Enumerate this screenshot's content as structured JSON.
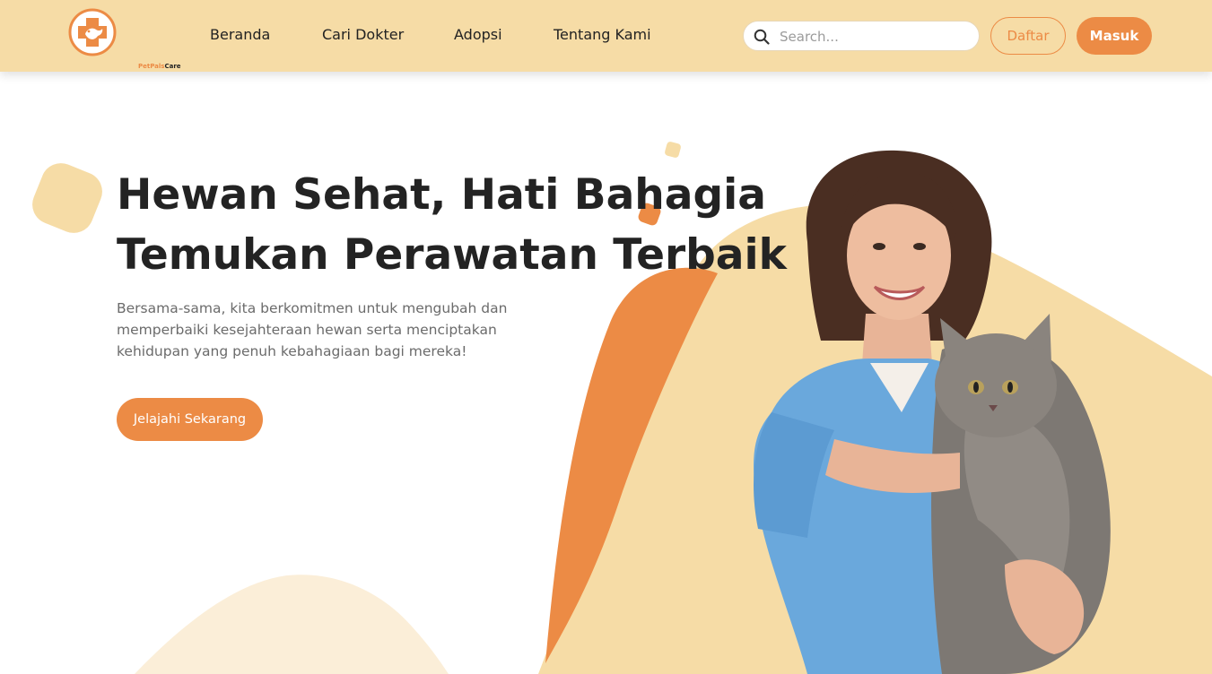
{
  "brand": {
    "name_part1": "PetPals",
    "name_part2": "Care"
  },
  "nav": {
    "items": [
      {
        "label": "Beranda"
      },
      {
        "label": "Cari Dokter"
      },
      {
        "label": "Adopsi"
      },
      {
        "label": "Tentang Kami"
      }
    ]
  },
  "search": {
    "placeholder": "Search...",
    "value": ""
  },
  "auth": {
    "register_label": "Daftar",
    "login_label": "Masuk"
  },
  "hero": {
    "title_line1": "Hewan Sehat, Hati Bahagia",
    "title_line2": "Temukan Perawatan Terbaik",
    "description": "Bersama-sama, kita berkomitmen untuk mengubah dan memperbaiki kesejahteraan hewan serta menciptakan kehidupan yang penuh kebahagiaan bagi mereka!",
    "cta_label": "Jelajahi Sekarang"
  },
  "colors": {
    "header_bg": "#f6dca6",
    "accent": "#ec8b45",
    "soft_yellow": "#f6dca6",
    "pale_yellow": "#fbeed8",
    "scrubs_blue": "#6aa8dc",
    "title": "#232323",
    "body_text": "#6b6b6b"
  },
  "icons": {
    "logo": "medical-cross-paw-icon",
    "search": "search-icon"
  }
}
